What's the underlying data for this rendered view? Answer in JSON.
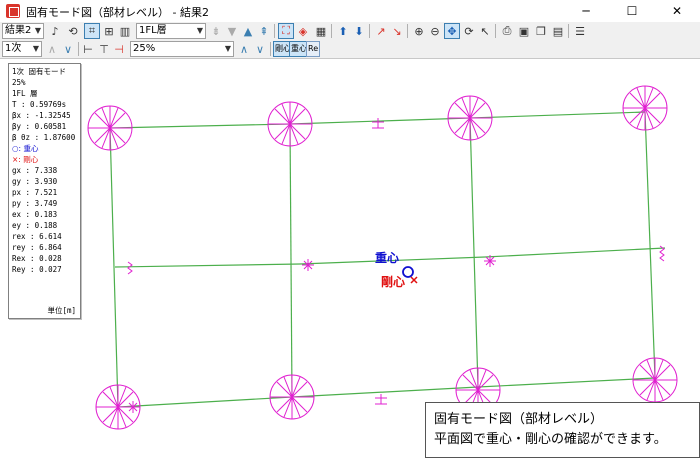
{
  "window": {
    "title": "固有モード図（部材レベル） - 結果2",
    "minimize": "─",
    "maximize": "☐",
    "close": "✕"
  },
  "toolbar1": {
    "result_select": "結果2",
    "floor_select": "1FL層"
  },
  "toolbar2": {
    "mode_select": "1次",
    "scale_select": "25%",
    "btn_gravity": "剛心",
    "btn_rigid": "重心",
    "btn_re": "Re"
  },
  "info": {
    "mode": "1次 固有モード",
    "scale": "25%",
    "floor": "1FL 層",
    "T": "T : 0.59769s",
    "bx": "βx : -1.32545",
    "by": "βy :  0.60581",
    "btz": "β θz :  1.87600",
    "legend_g": "○: 重心",
    "legend_r": "×: 剛心",
    "gx": "gx : 7.338",
    "gy": "gy : 3.930",
    "px": "px : 7.521",
    "py": "py : 3.749",
    "ex": "ex : 0.183",
    "ey": "ey : 0.188",
    "rex": "rex : 6.614",
    "rey": "rey : 6.864",
    "Rex": "Rex : 0.028",
    "Rey": "Rey : 0.027",
    "unit": "単位[m]"
  },
  "plan": {
    "label_g": "重心",
    "label_r": "剛心"
  },
  "caption": {
    "line1": "固有モード図（部材レベル）",
    "line2": "平面図で重心・剛心の確認ができます。"
  },
  "colors": {
    "member": "#4caf4c",
    "mode": "#e020d0",
    "center_g": "#1010d0",
    "center_r": "#e01010"
  }
}
